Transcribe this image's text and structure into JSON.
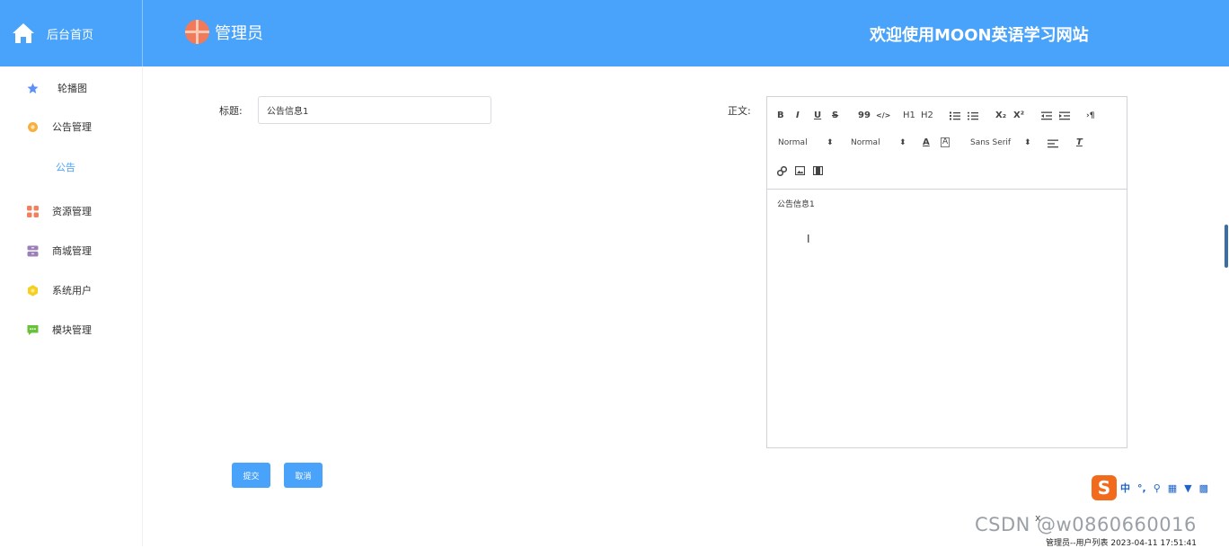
{
  "header": {
    "home_label": "后台首页",
    "admin_label": "管理员",
    "welcome": "欢迎使用MOON英语学习网站",
    "background_color": "#4aa3fb"
  },
  "sidebar": {
    "items": [
      {
        "label": "轮播图",
        "icon": "star-icon",
        "color": "#5b8ff9"
      },
      {
        "label": "公告管理",
        "icon": "gear-icon",
        "color": "#f5b041"
      },
      {
        "label": "公告",
        "icon": "",
        "color": "#4aa3fb"
      },
      {
        "label": "资源管理",
        "icon": "grid-icon",
        "color": "#f08060"
      },
      {
        "label": "商城管理",
        "icon": "archive-icon",
        "color": "#9b7fb8"
      },
      {
        "label": "系统用户",
        "icon": "hexagon-icon",
        "color": "#f5d020"
      },
      {
        "label": "模块管理",
        "icon": "message-icon",
        "color": "#67c23a"
      }
    ]
  },
  "form": {
    "title_label": "标题:",
    "title_value": "公告信息1",
    "body_label": "正文:",
    "body_text": "公告信息1",
    "submit_label": "提交",
    "cancel_label": "取消"
  },
  "editor_toolbar": {
    "row1": [
      "B",
      "I",
      "U",
      "S",
      "99",
      "</>",
      "H1",
      "H2",
      "ordered-list-icon",
      "bullet-list-icon",
      "X₂",
      "X²",
      "outdent-icon",
      "indent-icon",
      "direction-icon"
    ],
    "header_select": "Normal",
    "size_select": "Normal",
    "font_select": "Sans Serif"
  },
  "overlay": {
    "ime_zh": "中",
    "watermark": "CSDN @w0860660016",
    "status_text": "管理员--用户列表 2023-04-11 17:51:41",
    "close": "x"
  }
}
